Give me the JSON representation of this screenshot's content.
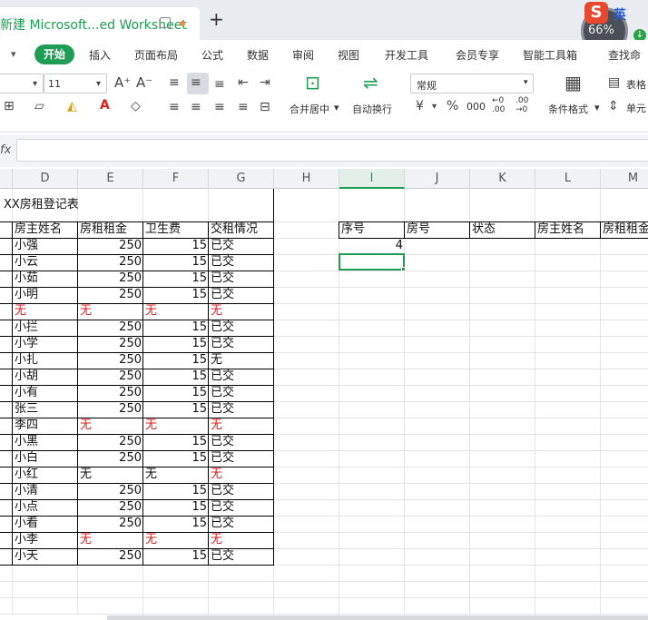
{
  "window": {
    "doc_title": "新建 Microsoft...ed Worksheet",
    "new_tab": "+"
  },
  "overlay": {
    "badge": "S",
    "lang": "英",
    "percent": "66%",
    "down": "↓"
  },
  "menu": {
    "active": "开始",
    "items": [
      "插入",
      "页面布局",
      "公式",
      "数据",
      "审阅",
      "视图",
      "开发工具",
      "会员专享",
      "智能工具箱",
      "查找命"
    ]
  },
  "ribbon": {
    "font_size": "11",
    "number_format": "常规",
    "merge_label": "合并居中",
    "wrap_label": "自动换行",
    "cond_format_label": "条件格式",
    "table_label": "表格",
    "cell_label": "单元",
    "yen": "¥",
    "percent": "%",
    "thousand": "000",
    "dec_inc": "+0\n.00",
    "dec_dec": "-.00\n→.0"
  },
  "formula": {
    "fx": "fx",
    "value": ""
  },
  "columns": [
    "D",
    "E",
    "F",
    "G",
    "H",
    "I",
    "J",
    "K",
    "L",
    "M"
  ],
  "active_column": "I",
  "sheet": {
    "title": "XX房租登记表",
    "headers": [
      "房主姓名",
      "房租租金",
      "卫生费",
      "交租情况"
    ],
    "rows": [
      {
        "name": "小强",
        "rent": "250",
        "fee": "15",
        "status": "已交",
        "red": false
      },
      {
        "name": "小云",
        "rent": "250",
        "fee": "15",
        "status": "已交",
        "red": false
      },
      {
        "name": "小茹",
        "rent": "250",
        "fee": "15",
        "status": "已交",
        "red": false
      },
      {
        "name": "小明",
        "rent": "250",
        "fee": "15",
        "status": "已交",
        "red": false
      },
      {
        "name": "无",
        "rent": "无",
        "fee": "无",
        "status": "无",
        "red": true,
        "red_cols": [
          "name",
          "rent",
          "fee",
          "status"
        ]
      },
      {
        "name": "小拦",
        "rent": "250",
        "fee": "15",
        "status": "已交",
        "red": false
      },
      {
        "name": "小学",
        "rent": "250",
        "fee": "15",
        "status": "已交",
        "red": false
      },
      {
        "name": "小扎",
        "rent": "250",
        "fee": "15",
        "status": "无",
        "red": false
      },
      {
        "name": "小胡",
        "rent": "250",
        "fee": "15",
        "status": "已交",
        "red": false
      },
      {
        "name": "小有",
        "rent": "250",
        "fee": "15",
        "status": "已交",
        "red": false
      },
      {
        "name": "张三",
        "rent": "250",
        "fee": "15",
        "status": "已交",
        "red": false
      },
      {
        "name": "李四",
        "rent": "无",
        "fee": "无",
        "status": "无",
        "red": true,
        "red_cols": [
          "rent",
          "fee",
          "status"
        ]
      },
      {
        "name": "小黑",
        "rent": "250",
        "fee": "15",
        "status": "已交",
        "red": false
      },
      {
        "name": "小白",
        "rent": "250",
        "fee": "15",
        "status": "已交",
        "red": false
      },
      {
        "name": "小红",
        "rent": "无",
        "fee": "无",
        "status": "无",
        "red": true,
        "red_cols": [
          "status"
        ]
      },
      {
        "name": "小清",
        "rent": "250",
        "fee": "15",
        "status": "已交",
        "red": false
      },
      {
        "name": "小点",
        "rent": "250",
        "fee": "15",
        "status": "已交",
        "red": false
      },
      {
        "name": "小看",
        "rent": "250",
        "fee": "15",
        "status": "已交",
        "red": false
      },
      {
        "name": "小李",
        "rent": "无",
        "fee": "无",
        "status": "无",
        "red": true,
        "red_cols": [
          "rent",
          "fee",
          "status"
        ]
      },
      {
        "name": "小天",
        "rent": "250",
        "fee": "15",
        "status": "已交",
        "red": false
      }
    ],
    "right_headers": [
      "序号",
      "房号",
      "状态",
      "房主姓名",
      "房租租金"
    ],
    "right_value": "4"
  }
}
